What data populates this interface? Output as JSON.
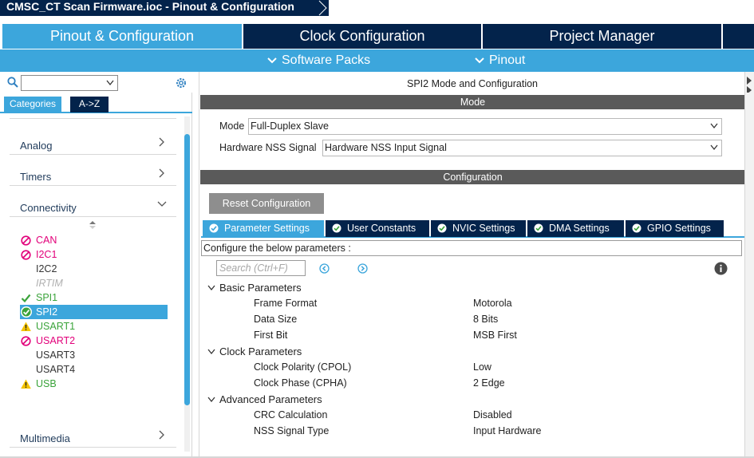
{
  "window": {
    "title": "CMSC_CT Scan Firmware.ioc - Pinout & Configuration"
  },
  "main_tabs": [
    {
      "label": "Pinout & Configuration",
      "active": true
    },
    {
      "label": "Clock Configuration",
      "active": false
    },
    {
      "label": "Project Manager",
      "active": false
    }
  ],
  "sub_menu": {
    "software_packs": "Software Packs",
    "pinout": "Pinout"
  },
  "left_panel": {
    "search_value": "",
    "tabs": {
      "categories": "Categories",
      "az": "A->Z"
    },
    "groups": {
      "analog": "Analog",
      "timers": "Timers",
      "connectivity": "Connectivity",
      "multimedia": "Multimedia"
    },
    "peripherals": [
      {
        "label": "CAN",
        "status": "error",
        "color": "#e2007a"
      },
      {
        "label": "I2C1",
        "status": "error",
        "color": "#e2007a"
      },
      {
        "label": "I2C2",
        "status": "none",
        "color": "#333333"
      },
      {
        "label": "IRTIM",
        "status": "disabled",
        "color": "#b0b0b0"
      },
      {
        "label": "SPI1",
        "status": "ok",
        "color": "#3aa33a"
      },
      {
        "label": "SPI2",
        "status": "ok-selected",
        "color": "#ffffff"
      },
      {
        "label": "USART1",
        "status": "warning",
        "color": "#3aa33a"
      },
      {
        "label": "USART2",
        "status": "error",
        "color": "#e2007a"
      },
      {
        "label": "USART3",
        "status": "none",
        "color": "#333333"
      },
      {
        "label": "USART4",
        "status": "none",
        "color": "#333333"
      },
      {
        "label": "USB",
        "status": "warning",
        "color": "#3aa33a"
      }
    ]
  },
  "right_panel": {
    "title": "SPI2 Mode and Configuration",
    "mode_header": "Mode",
    "mode_label": "Mode",
    "mode_value": "Full-Duplex Slave",
    "nss_label": "Hardware NSS Signal",
    "nss_value": "Hardware NSS Input Signal",
    "config_header": "Configuration",
    "reset_button": "Reset Configuration",
    "tabs": [
      "Parameter Settings",
      "User Constants",
      "NVIC Settings",
      "DMA Settings",
      "GPIO Settings"
    ],
    "configure_text": "Configure the below parameters :",
    "search_placeholder": "Search (Ctrl+F)",
    "groups": [
      {
        "name": "Basic Parameters",
        "params": [
          {
            "name": "Frame Format",
            "value": "Motorola"
          },
          {
            "name": "Data Size",
            "value": "8 Bits"
          },
          {
            "name": "First Bit",
            "value": "MSB First"
          }
        ]
      },
      {
        "name": "Clock Parameters",
        "params": [
          {
            "name": "Clock Polarity (CPOL)",
            "value": "Low"
          },
          {
            "name": "Clock Phase (CPHA)",
            "value": "2 Edge"
          }
        ]
      },
      {
        "name": "Advanced Parameters",
        "params": [
          {
            "name": "CRC Calculation",
            "value": "Disabled"
          },
          {
            "name": "NSS Signal Type",
            "value": "Input Hardware"
          }
        ]
      }
    ]
  },
  "colors": {
    "dark_blue": "#03234b",
    "accent_blue": "#3ca6dc",
    "section_gray": "#5a5a5a",
    "error_pink": "#e2007a",
    "ok_green": "#3aa33a",
    "warning_yellow": "#f5c400"
  }
}
